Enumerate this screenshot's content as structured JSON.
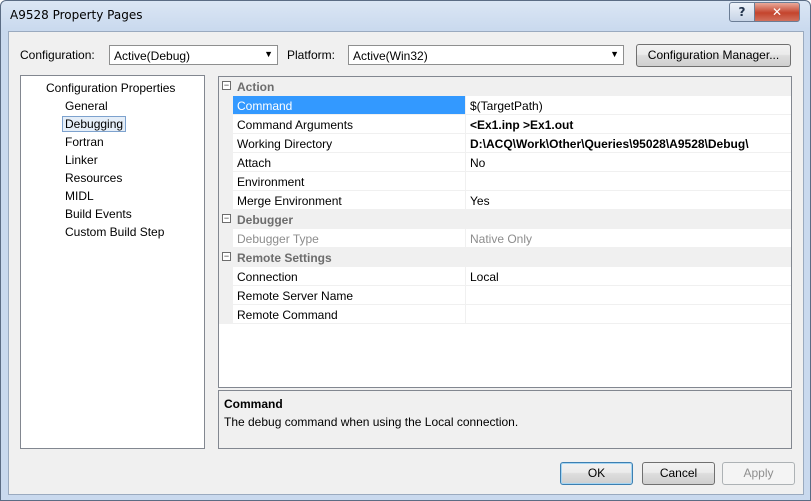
{
  "window": {
    "title": "A9528 Property Pages",
    "help_label": "?",
    "close_label": "✕"
  },
  "toolbar": {
    "configuration_label": "Configuration:",
    "configuration_value": "Active(Debug)",
    "platform_label": "Platform:",
    "platform_value": "Active(Win32)",
    "config_manager_label": "Configuration Manager..."
  },
  "tree": {
    "root": "Configuration Properties",
    "items": [
      "General",
      "Debugging",
      "Fortran",
      "Linker",
      "Resources",
      "MIDL",
      "Build Events",
      "Custom Build Step"
    ],
    "selected": "Debugging"
  },
  "grid": {
    "categories": [
      {
        "label": "Action",
        "expander": "−"
      },
      {
        "label": "Debugger",
        "expander": "−"
      },
      {
        "label": "Remote Settings",
        "expander": "−"
      }
    ],
    "rows": [
      {
        "name": "Command",
        "value": "$(TargetPath)",
        "bold": false,
        "selected": true
      },
      {
        "name": "Command Arguments",
        "value": "<Ex1.inp >Ex1.out",
        "bold": true
      },
      {
        "name": "Working Directory",
        "value": "D:\\ACQ\\Work\\Other\\Queries\\95028\\A9528\\Debug\\",
        "bold": true
      },
      {
        "name": "Attach",
        "value": "No",
        "bold": false
      },
      {
        "name": "Environment",
        "value": "",
        "bold": false
      },
      {
        "name": "Merge Environment",
        "value": "Yes",
        "bold": false
      },
      {
        "name": "Debugger Type",
        "value": "Native Only",
        "readonly": true
      },
      {
        "name": "Connection",
        "value": "Local",
        "bold": false
      },
      {
        "name": "Remote Server Name",
        "value": "",
        "bold": false
      },
      {
        "name": "Remote Command",
        "value": "",
        "bold": false
      }
    ]
  },
  "description": {
    "title": "Command",
    "text": "The debug command when using the Local connection."
  },
  "buttons": {
    "ok": "OK",
    "cancel": "Cancel",
    "apply": "Apply"
  }
}
